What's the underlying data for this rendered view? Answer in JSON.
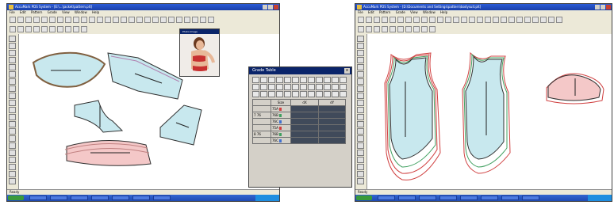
{
  "left_window": {
    "title": "AccuMark PDS System - [E:\\...\\jacket\\pattern.plt]",
    "menu": [
      "File",
      "Edit",
      "Pattern",
      "Grade",
      "View",
      "Window",
      "Help"
    ],
    "status": "Ready"
  },
  "right_window": {
    "title": "AccuMark PDS System - [D:\\Documents and Settings\\pattern\\bodysuit.plt]",
    "menu": [
      "File",
      "Edit",
      "Pattern",
      "Grade",
      "View",
      "Window",
      "Help"
    ],
    "status": "Ready"
  },
  "photo_panel": {
    "title": "Photo Image"
  },
  "grade_table": {
    "title": "Grade Table",
    "close": "x",
    "columns": [
      "",
      "Size",
      "dX",
      "dY"
    ],
    "rows": [
      {
        "group": "",
        "size": "75A"
      },
      {
        "group": "7 76",
        "size": "76B"
      },
      {
        "group": "",
        "size": "76C"
      },
      {
        "group": "",
        "size": "75A"
      },
      {
        "group": "8 76",
        "size": "76B"
      },
      {
        "group": "",
        "size": "76C"
      }
    ]
  },
  "colors": {
    "piece_fill_blue": "#c8e8ee",
    "piece_fill_pink": "#f4c8c8",
    "piece_outline": "#303030",
    "grade_red": "#d04040",
    "grade_green": "#40a060",
    "grade_blue": "#4070d0",
    "title_blue": "#2a5bd7",
    "taskbar_blue": "#2a58c4"
  },
  "icons": [
    "start-icon",
    "minimize-icon",
    "maximize-icon",
    "close-icon",
    "arrow-icon",
    "ruler-icon"
  ]
}
